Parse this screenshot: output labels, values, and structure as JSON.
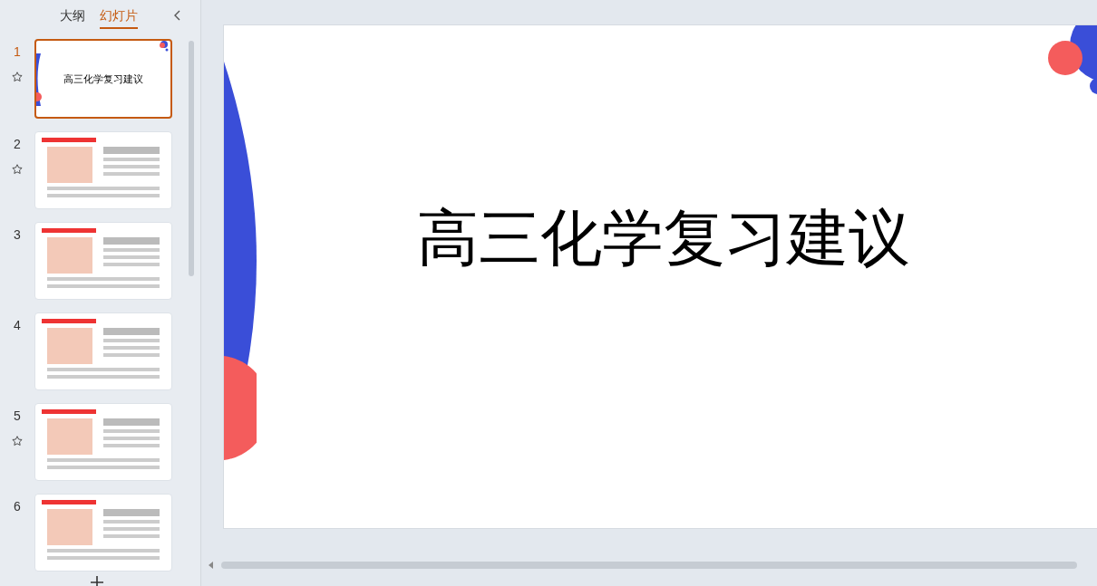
{
  "panel_tabs": [
    {
      "label": "大纲",
      "selected": false
    },
    {
      "label": "幻灯片",
      "selected": true
    }
  ],
  "slides": [
    {
      "number": "1",
      "kind": "title",
      "title": "高三化学复习建议",
      "selected": true,
      "star_icon": true
    },
    {
      "number": "2",
      "kind": "content",
      "selected": false,
      "star_icon": true
    },
    {
      "number": "3",
      "kind": "content",
      "selected": false,
      "star_icon": false
    },
    {
      "number": "4",
      "kind": "content",
      "selected": false,
      "star_icon": false
    },
    {
      "number": "5",
      "kind": "content",
      "selected": false,
      "star_icon": true
    },
    {
      "number": "6",
      "kind": "content",
      "selected": false,
      "star_icon": false
    }
  ],
  "editor": {
    "title": "高三化学复习建议"
  }
}
